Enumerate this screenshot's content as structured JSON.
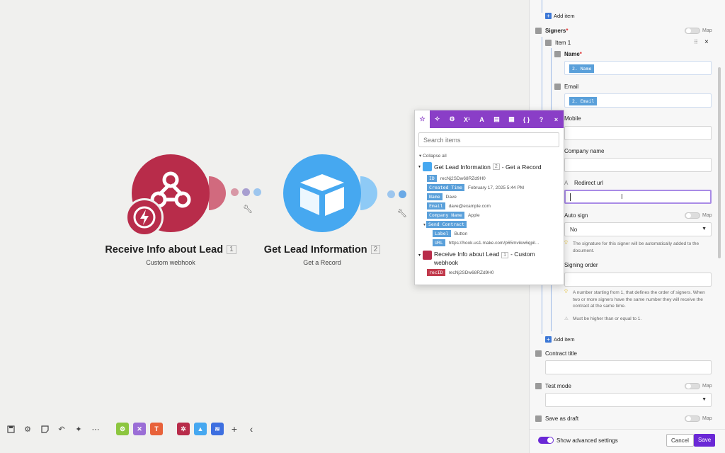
{
  "modules": [
    {
      "title": "Receive Info about Lead",
      "number": "1",
      "subtitle": "Custom webhook",
      "color": "#b82c4a",
      "icon": "webhook-icon"
    },
    {
      "title": "Get Lead Information",
      "number": "2",
      "subtitle": "Get a Record",
      "color": "#46a8f0",
      "icon": "airtable-icon"
    }
  ],
  "toolbar": {
    "items": [
      "save-icon",
      "settings-icon",
      "notes-icon",
      "undo-icon",
      "magic-wand-icon",
      "more-icon"
    ],
    "modules": [
      "tools-icon",
      "flow-control-icon",
      "text-parser-icon",
      "webhook-icon",
      "airtable-icon",
      "make-icon"
    ],
    "add": "+",
    "collapse": "‹"
  },
  "popup": {
    "tabs": [
      "star-icon",
      "sparkle-icon",
      "gear-icon",
      "superscript-icon",
      "text-icon",
      "calendar-icon",
      "table-icon",
      "braces-icon",
      "?",
      "×"
    ],
    "search_placeholder": "Search items",
    "collapse_label": "Collapse all",
    "group1": {
      "title": "Get Lead Information",
      "number": "2",
      "suffix": "- Get a Record",
      "rows": [
        {
          "tag": "ID",
          "value": "recNj2SDw68RZd9H0"
        },
        {
          "tag": "Created Time",
          "value": "February 17, 2025 5:44 PM"
        },
        {
          "tag": "Name",
          "value": "Dave"
        },
        {
          "tag": "Email",
          "value": "dave@example.com"
        },
        {
          "tag": "Company Name",
          "value": "Apple"
        },
        {
          "tag": "Send Contract",
          "value": ""
        },
        {
          "tag": "Label",
          "value": "Button"
        },
        {
          "tag": "URL",
          "value": "https://hook.us1.make.com/p65mvikw6qpil..."
        }
      ]
    },
    "group2": {
      "title": "Receive Info about Lead",
      "number": "1",
      "suffix": "- Custom webhook",
      "row": {
        "tag": "recID",
        "value": "recNj2SDw68RZd9H0"
      }
    }
  },
  "panel": {
    "add_item_top": "Add item",
    "signers": "Signers",
    "required": "*",
    "map": "Map",
    "item1": "Item 1",
    "drag_handle": "⠿",
    "remove": "×",
    "name_label": "Name",
    "name_value": "2. Name",
    "email_label": "Email",
    "email_value": "2. Email",
    "mobile_label": "Mobile",
    "company_label": "Company name",
    "redirect_prefix": "A",
    "redirect_label": "Redirect url",
    "auto_sign_label": "Auto sign",
    "auto_sign_value": "No",
    "auto_sign_hint": "The signature for this signer will be automatically added to the document.",
    "signing_order_label": "Signing order",
    "signing_order_hint": "A number starting from 1, that defines the order of signers. When two or more signers have the same number they will receive the contract at the same time.",
    "signing_order_hint2": "Must be higher than or equal to 1.",
    "add_item_bottom": "Add item",
    "contract_title_label": "Contract title",
    "test_mode_label": "Test mode",
    "save_draft_label": "Save as draft",
    "show_advanced": "Show advanced settings",
    "cancel": "Cancel",
    "save": "Save"
  }
}
